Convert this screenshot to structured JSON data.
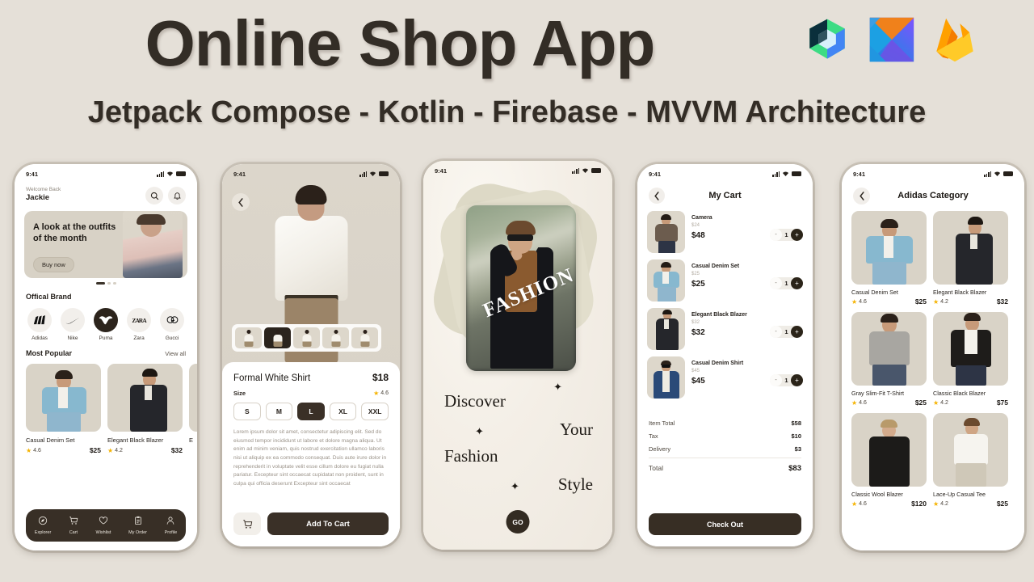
{
  "header": {
    "title": "Online Shop App",
    "subtitle": "Jetpack Compose - Kotlin - Firebase - MVVM Architecture",
    "logos": [
      "jetpack-compose-logo",
      "kotlin-logo",
      "firebase-logo"
    ],
    "title_color": "#332d26",
    "background_color": "#e5e0d8"
  },
  "status_bar": {
    "time": "9:41",
    "signal": "signal-bars-icon",
    "wifi": "wifi-icon",
    "battery": "battery-icon"
  },
  "screens": {
    "home": {
      "welcome_label": "Welcome Back",
      "user_name": "Jackie",
      "search_icon": "search-icon",
      "bell_icon": "bell-icon",
      "banner": {
        "headline": "A look at the outfits of the month",
        "cta": "Buy now",
        "dots": 3,
        "active_dot": 0
      },
      "brand_section_title": "Offical Brand",
      "brands": [
        {
          "label": "Adidas",
          "glyph": "▲",
          "active": false
        },
        {
          "label": "Nike",
          "glyph": "✔",
          "active": false
        },
        {
          "label": "Puma",
          "glyph": "ʕ",
          "active": true
        },
        {
          "label": "Zara",
          "glyph": "ZARA",
          "active": false
        },
        {
          "label": "Gucci",
          "glyph": "Ⓖ",
          "active": false
        }
      ],
      "popular_title": "Most Popular",
      "view_all": "View all",
      "popular": [
        {
          "name": "Casual Denim Set",
          "rating": "4.6",
          "price": "$25"
        },
        {
          "name": "Elegant Black Blazer",
          "rating": "4.2",
          "price": "$32"
        }
      ],
      "bottom_nav": [
        {
          "label": "Explorer",
          "icon": "compass-icon"
        },
        {
          "label": "Cart",
          "icon": "cart-icon"
        },
        {
          "label": "Wishlist",
          "icon": "heart-icon"
        },
        {
          "label": "My Order",
          "icon": "clipboard-icon"
        },
        {
          "label": "Profile",
          "icon": "person-icon"
        }
      ]
    },
    "detail": {
      "back_icon": "chevron-left-icon",
      "product_name": "Formal White Shirt",
      "price": "$18",
      "size_label": "Size",
      "rating": "4.6",
      "sizes": [
        {
          "label": "S",
          "selected": false
        },
        {
          "label": "M",
          "selected": false
        },
        {
          "label": "L",
          "selected": true
        },
        {
          "label": "XL",
          "selected": false
        },
        {
          "label": "XXL",
          "selected": false
        }
      ],
      "description": "Lorem ipsum dolor sit amet, consectetur adipiscing elit. Sed do eiusmod tempor incididunt ut labore et dolore magna aliqua. Ut enim ad minim veniam, quis nostrud exercitation ullamco laboris nisi ut aliquip ex ea commodo consequat. Duis aute irure dolor in reprehenderit in voluptate velit esse cillum dolore eu fugiat nulla pariatur. Excepteur sint occaecat cupidatat non proident, sunt in culpa qui officia deserunt Excepteur sint occaecat",
      "cart_icon": "cart-icon",
      "add_to_cart": "Add To Cart",
      "thumbnails": 5,
      "selected_thumbnail": 1
    },
    "onboarding": {
      "badge_word": "FASHION",
      "words": [
        "Discover",
        "Your",
        "Fashion",
        "Style"
      ],
      "go_label": "GO",
      "sparkle": "✦"
    },
    "cart": {
      "back_icon": "chevron-left-icon",
      "title": "My Cart",
      "items": [
        {
          "name": "Camera",
          "old_price": "$24",
          "price": "$48",
          "qty": "1"
        },
        {
          "name": "Casual Denim Set",
          "old_price": "$25",
          "price": "$25",
          "qty": "1"
        },
        {
          "name": "Elegant Black Blazer",
          "old_price": "$32",
          "price": "$32",
          "qty": "1"
        },
        {
          "name": "Casual Denim Shirt",
          "old_price": "$45",
          "price": "$45",
          "qty": "1"
        }
      ],
      "minus_label": "-",
      "plus_label": "+",
      "totals": [
        {
          "label": "Item Total",
          "value": "$58"
        },
        {
          "label": "Tax",
          "value": "$10"
        },
        {
          "label": "Delivery",
          "value": "$3"
        }
      ],
      "grand_total": {
        "label": "Total",
        "value": "$83"
      },
      "checkout_label": "Check Out"
    },
    "category": {
      "back_icon": "chevron-left-icon",
      "title": "Adidas Category",
      "products": [
        {
          "name": "Casual Denim Set",
          "rating": "4.6",
          "price": "$25"
        },
        {
          "name": "Elegant Black Blazer",
          "rating": "4.2",
          "price": "$32"
        },
        {
          "name": "Gray Slim-Fit T-Shirt",
          "rating": "4.6",
          "price": "$25"
        },
        {
          "name": "Classic Black Blazer",
          "rating": "4.2",
          "price": "$75"
        },
        {
          "name": "Classic Wool Blazer",
          "rating": "4.6",
          "price": "$120"
        },
        {
          "name": "Lace-Up Casual Tee",
          "rating": "4.2",
          "price": "$25"
        }
      ]
    }
  }
}
